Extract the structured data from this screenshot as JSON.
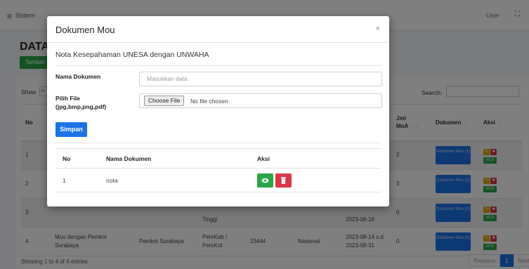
{
  "navbar": {
    "title": "Sistem",
    "user": "User"
  },
  "page": {
    "title": "DATA",
    "add_button": "Tambah"
  },
  "table": {
    "show_label": "Show",
    "show_value": "10",
    "search_label": "Search:",
    "headers": {
      "no": "No",
      "jml_moa": "Jml MoA",
      "dokumen": "Dokumen",
      "aksi": "Aksi"
    },
    "rows": [
      {
        "no": "1",
        "c1": "",
        "c2": "",
        "c3": "",
        "c4": "",
        "c5": "",
        "c6": "",
        "moa": "2",
        "dok": "Dokumen Mou (1)"
      },
      {
        "no": "2",
        "c1": "",
        "c2": "",
        "c3": "",
        "c4": "",
        "c5": "",
        "c6": "",
        "moa": "3",
        "dok": "Dokumen Mou (0)"
      },
      {
        "no": "3",
        "c1": "",
        "c2": "",
        "c3": "Tinggi",
        "c4": "",
        "c5": "",
        "c6": "2023-08-18",
        "moa": "0",
        "dok": "Dokumen Mou (0)"
      },
      {
        "no": "4",
        "c1": "Mou dengan Pemkot Surabaya",
        "c2": "Pemkot Surabaya",
        "c3": "PemKab / PemKot",
        "c4": "23444",
        "c5": "Nasional",
        "c6": "2023-08-14 s.d 2023-08-31",
        "moa": "0",
        "dok": "Dokumen Mou (0)"
      }
    ],
    "moa_label": "MOA",
    "showing": "Showing 1 to 4 of 4 entries",
    "pager": {
      "previous": "Previous",
      "page": "1",
      "next": "Next"
    }
  },
  "modal": {
    "title": "Dokumen Mou",
    "close": "×",
    "subtitle": "Nota Kesepahaman UNESA dengan UNWAHA",
    "nama_label": "Nama Dokumen",
    "nama_placeholder": "Masukkan data",
    "file_label": "Pilih File (jpg,bmp,png,pdf)",
    "file_button": "Choose File",
    "file_status": "No file chosen",
    "submit": "Simpan",
    "list": {
      "headers": {
        "no": "No",
        "nama": "Nama Dokumen",
        "aksi": "Aksi"
      },
      "rows": [
        {
          "no": "1",
          "nama": "nota"
        }
      ]
    }
  },
  "colors": {
    "primary": "#1a73e8",
    "success": "#28a745",
    "danger": "#dc3545",
    "warning": "#e0a800"
  }
}
